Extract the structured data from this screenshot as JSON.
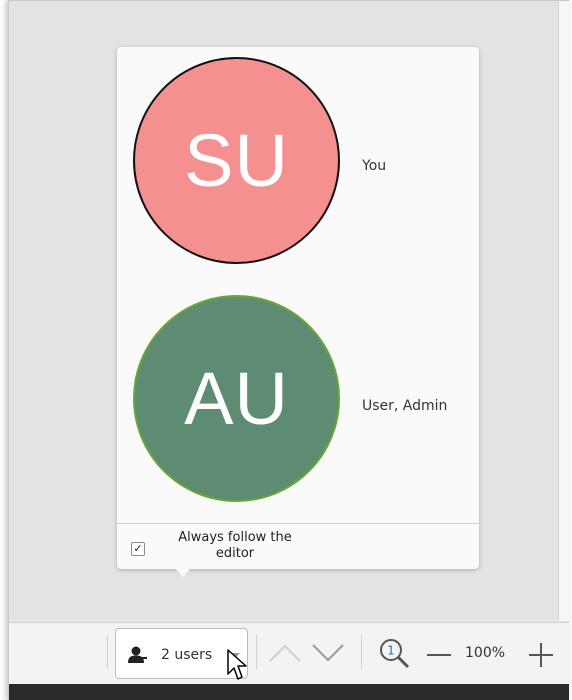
{
  "users_popup": {
    "users": [
      {
        "initials": "SU",
        "name": "You",
        "avatar_color": "#f59090",
        "border_color": "#111111"
      },
      {
        "initials": "AU",
        "name": "User, Admin",
        "avatar_color": "#5e8c72",
        "border_color": "#6aa53a"
      }
    ],
    "follow_editor": {
      "label": "Always follow the editor",
      "checked": true
    }
  },
  "statusbar": {
    "users_button_label": "2 users",
    "zoom_level": "100%"
  },
  "icons": [
    "user-icon",
    "dropdown-caret-icon",
    "chevron-up-icon",
    "chevron-down-icon",
    "zoom-icon",
    "minus-icon",
    "plus-icon",
    "check-icon",
    "cursor-icon"
  ]
}
